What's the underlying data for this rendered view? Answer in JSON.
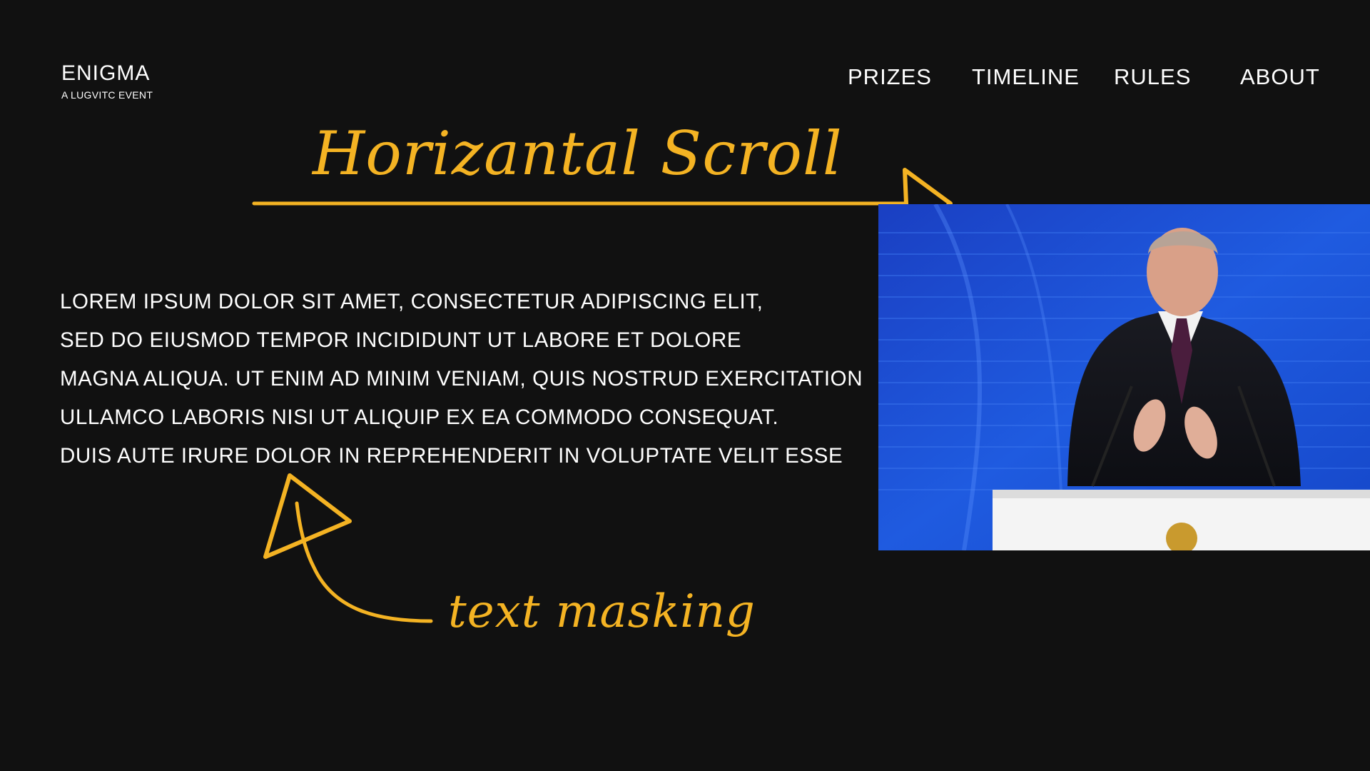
{
  "brand": {
    "title": "ENIGMA",
    "subtitle": "A LUGVITC EVENT"
  },
  "nav": {
    "items": [
      "PRIZES",
      "TIMELINE",
      "RULES",
      "ABOUT"
    ]
  },
  "annotations": {
    "top": "Horizantal Scroll",
    "bottom": "text masking",
    "accent_color": "#F4B323"
  },
  "body": {
    "lines": [
      "LOREM IPSUM DOLOR SIT AMET, CONSECTETUR ADIPISCING ELIT,",
      "SED DO EIUSMOD TEMPOR INCIDIDUNT UT LABORE ET DOLORE",
      "MAGNA ALIQUA. UT ENIM AD MINIM VENIAM, QUIS NOSTRUD EXERCITATION",
      "ULLAMCO LABORIS NISI UT ALIQUIP EX EA COMMODO CONSEQUAT.",
      "DUIS AUTE IRURE DOLOR IN REPREHENDERIT IN VOLUPTATE VELIT ESSE"
    ]
  },
  "colors": {
    "background": "#111111",
    "text": "#FFFFFF",
    "photo_backdrop": "#1D4FD6"
  }
}
